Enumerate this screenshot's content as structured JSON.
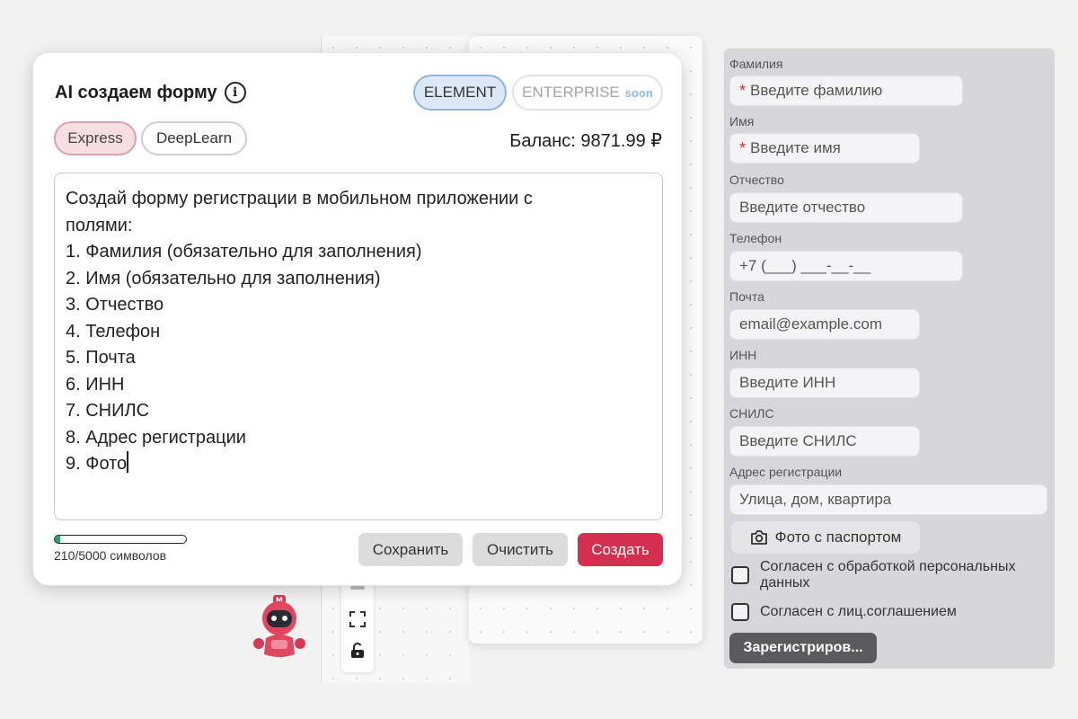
{
  "dialog": {
    "title": "AI создаем форму",
    "modes": {
      "element": "ELEMENT",
      "enterprise": "ENTERPRISE",
      "soon": "soon"
    },
    "models": {
      "express": "Express",
      "deeplearn": "DeepLearn"
    },
    "balance": "Баланс: 9871.99 ₽",
    "prompt_lines": [
      "Создай форму регистрации в мобильном приложении с",
      "полями:",
      "1. Фамилия (обязательно для заполнения)",
      "2. Имя (обязательно для заполнения)",
      "3. Отчество",
      "4. Телефон",
      "5. Почта",
      "6. ИНН",
      "7. СНИЛС",
      "8. Адрес регистрации",
      "9. Фото"
    ],
    "char_count_text": "210/5000 символов",
    "char_progress": 0.042,
    "buttons": {
      "save": "Сохранить",
      "clear": "Очистить",
      "create": "Создать"
    }
  },
  "form": {
    "fields": [
      {
        "label": "Фамилия",
        "placeholder": "Введите фамилию",
        "required": true
      },
      {
        "label": "Имя",
        "placeholder": "Введите имя",
        "required": true
      },
      {
        "label": "Отчество",
        "placeholder": "Введите отчество",
        "required": false
      },
      {
        "label": "Телефон",
        "placeholder": "+7 (___) ___-__-__",
        "required": false
      },
      {
        "label": "Почта",
        "placeholder": "email@example.com",
        "required": false
      },
      {
        "label": "ИНН",
        "placeholder": "Введите ИНН",
        "required": false
      },
      {
        "label": "СНИЛС",
        "placeholder": "Введите СНИЛС",
        "required": false
      },
      {
        "label": "Адрес регистрации",
        "placeholder": "Улица, дом, квартира",
        "required": false
      }
    ],
    "required_mark": "*",
    "photo_button": "Фото с паспортом",
    "checkboxes": [
      {
        "label_line1": "Согласен с обработкой персональных",
        "label_line2": "данных",
        "checked": false
      },
      {
        "label_line1": "Согласен с лиц.соглашением",
        "label_line2": "",
        "checked": false
      }
    ],
    "submit": "Зарегистриров..."
  },
  "colors": {
    "accent_red": "#d42f4f",
    "express_bg": "#f7dee3",
    "element_bg": "#dde8f6",
    "progress_green": "#27a36a"
  },
  "icons": [
    "info-icon",
    "camera-icon",
    "fullscreen-icon",
    "lock-icon",
    "robot-mascot-icon"
  ]
}
